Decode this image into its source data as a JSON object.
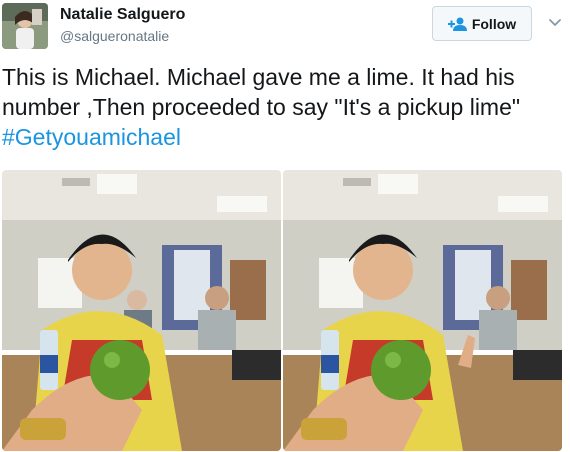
{
  "user": {
    "display_name": "Natalie Salguero",
    "handle": "@salgueronatalie",
    "avatar_icon": "profile-photo"
  },
  "follow": {
    "label": "Follow",
    "icon": "follow-person-plus-icon",
    "accent": "#1b95e0"
  },
  "menu": {
    "icon": "chevron-down-icon"
  },
  "tweet": {
    "text": "This is Michael. Michael gave me a lime. It had his number ,Then proceeded to say \"It's a pickup lime\" ",
    "hashtag": "#Getyouamichael"
  },
  "media": {
    "photos": [
      {
        "name": "classroom-photo-1"
      },
      {
        "name": "classroom-photo-2"
      }
    ]
  },
  "colors": {
    "name": "#14171a",
    "handle": "#657786",
    "hashtag": "#1b95e0",
    "button_bg": "#f5f8fa",
    "button_border": "#cbd6dd"
  }
}
